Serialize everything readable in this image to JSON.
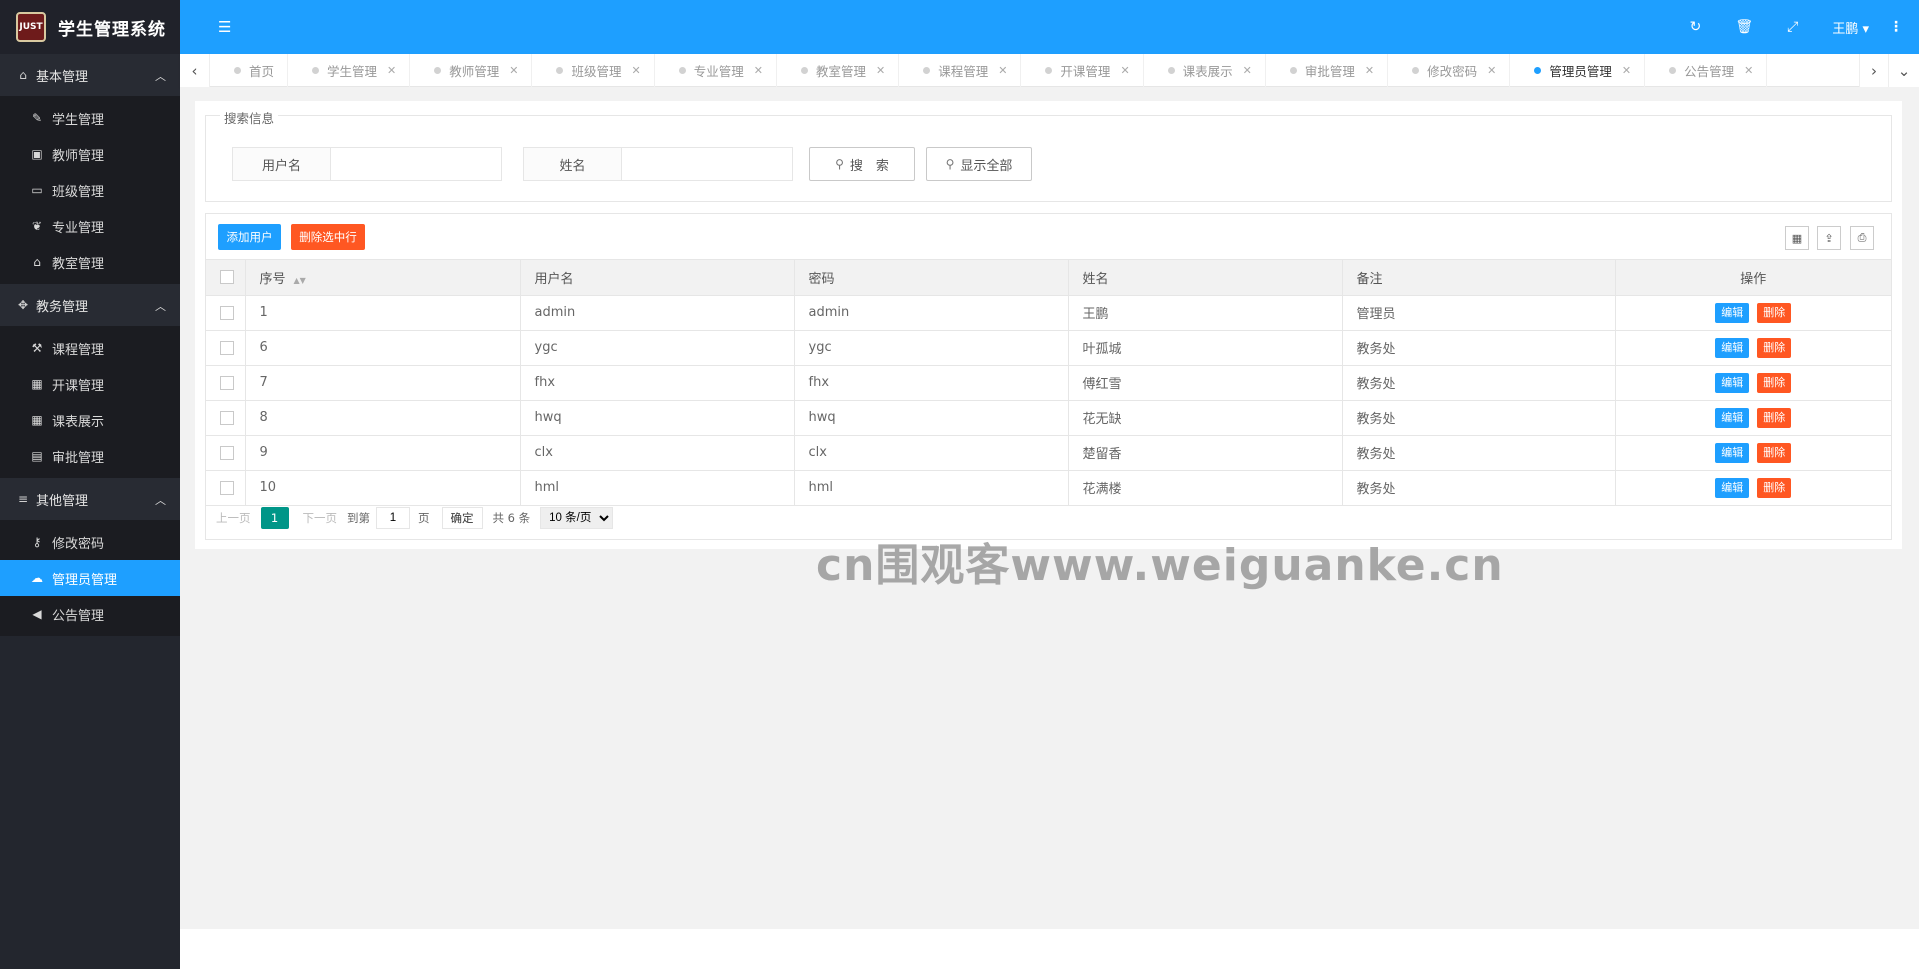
{
  "app": {
    "logo_text": "JUST",
    "title": "学生管理系统"
  },
  "header": {
    "user": "王鹏 ▾",
    "more": "⋮"
  },
  "sidebar": {
    "groups": [
      {
        "label": "基本管理",
        "icon": "home-icon",
        "items": [
          {
            "label": "学生管理",
            "icon": "pencil-icon"
          },
          {
            "label": "教师管理",
            "icon": "briefcase-icon"
          },
          {
            "label": "班级管理",
            "icon": "window-icon"
          },
          {
            "label": "专业管理",
            "icon": "leaf-icon"
          },
          {
            "label": "教室管理",
            "icon": "bank-icon"
          }
        ]
      },
      {
        "label": "教务管理",
        "icon": "graduation-cap-icon",
        "items": [
          {
            "label": "课程管理",
            "icon": "gavel-icon"
          },
          {
            "label": "开课管理",
            "icon": "calendar-icon"
          },
          {
            "label": "课表展示",
            "icon": "table-icon"
          },
          {
            "label": "审批管理",
            "icon": "book-icon"
          }
        ]
      },
      {
        "label": "其他管理",
        "icon": "bars-icon",
        "items": [
          {
            "label": "修改密码",
            "icon": "key-icon"
          },
          {
            "label": "管理员管理",
            "icon": "cloud-icon",
            "active": true
          },
          {
            "label": "公告管理",
            "icon": "bullhorn-icon"
          }
        ]
      }
    ]
  },
  "tabs": [
    {
      "label": "首页"
    },
    {
      "label": "学生管理"
    },
    {
      "label": "教师管理"
    },
    {
      "label": "班级管理"
    },
    {
      "label": "专业管理"
    },
    {
      "label": "教室管理"
    },
    {
      "label": "课程管理"
    },
    {
      "label": "开课管理"
    },
    {
      "label": "课表展示"
    },
    {
      "label": "审批管理"
    },
    {
      "label": "修改密码"
    },
    {
      "label": "管理员管理",
      "active": true
    },
    {
      "label": "公告管理"
    }
  ],
  "search": {
    "legend": "搜索信息",
    "username_label": "用户名",
    "name_label": "姓名",
    "username_value": "",
    "name_value": "",
    "search_button": "搜　索",
    "show_all_button": "显示全部"
  },
  "toolbar": {
    "add_label": "添加用户",
    "delete_label": "删除选中行"
  },
  "table": {
    "columns": [
      "序号",
      "用户名",
      "密码",
      "姓名",
      "备注",
      "操作"
    ],
    "edit_label": "编辑",
    "delete_label": "删除",
    "rows": [
      {
        "id": "1",
        "username": "admin",
        "password": "admin",
        "name": "王鹏",
        "note": "管理员"
      },
      {
        "id": "6",
        "username": "ygc",
        "password": "ygc",
        "name": "叶孤城",
        "note": "教务处"
      },
      {
        "id": "7",
        "username": "fhx",
        "password": "fhx",
        "name": "傅红雪",
        "note": "教务处"
      },
      {
        "id": "8",
        "username": "hwq",
        "password": "hwq",
        "name": "花无缺",
        "note": "教务处"
      },
      {
        "id": "9",
        "username": "clx",
        "password": "clx",
        "name": "楚留香",
        "note": "教务处"
      },
      {
        "id": "10",
        "username": "hml",
        "password": "hml",
        "name": "花满楼",
        "note": "教务处"
      }
    ]
  },
  "pager": {
    "prev": "上一页",
    "current": "1",
    "next": "下一页",
    "goto_label": "到第",
    "goto_value": "1",
    "page_unit": "页",
    "confirm": "确定",
    "total": "共 6 条",
    "page_size": "10 条/页"
  },
  "watermark": "cn围观客www.weiguanke.cn",
  "colors": {
    "primary": "#1e9fff",
    "danger": "#ff5722",
    "pager_active": "#009688",
    "sidebar_bg": "#23262e"
  }
}
